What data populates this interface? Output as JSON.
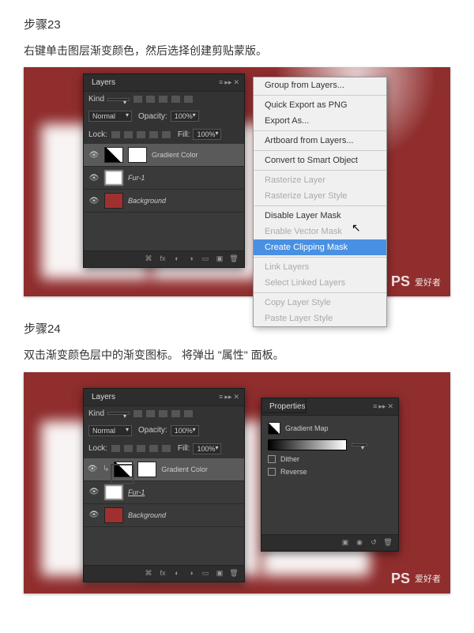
{
  "step23": {
    "title": "步骤23",
    "desc": "右键单击图层渐变颜色，然后选择创建剪贴蒙版。"
  },
  "step24": {
    "title": "步骤24",
    "desc": "双击渐变颜色层中的渐变图标。 将弹出 \"属性\" 面板。"
  },
  "layers": {
    "tab": "Layers",
    "kind_label": "Kind",
    "blend_mode": "Normal",
    "opacity_label": "Opacity:",
    "opacity_value": "100%",
    "lock_label": "Lock:",
    "fill_label": "Fill:",
    "fill_value": "100%",
    "item_gradient": "Gradient Color",
    "item_fur": "Fur-1",
    "item_bg": "Background",
    "foot_fx": "fx"
  },
  "ctx": {
    "group": "Group from Layers...",
    "export_png": "Quick Export as PNG",
    "export_as": "Export As...",
    "artboard": "Artboard from Layers...",
    "smart": "Convert to Smart Object",
    "rasterize": "Rasterize Layer",
    "rasterize_style": "Rasterize Layer Style",
    "disable_mask": "Disable Layer Mask",
    "vector_mask": "Enable Vector Mask",
    "clipping": "Create Clipping Mask",
    "link": "Link Layers",
    "select_linked": "Select Linked Layers",
    "copy_style": "Copy Layer Style",
    "paste_style": "Paste Layer Style"
  },
  "props": {
    "tab": "Properties",
    "title": "Gradient Map",
    "dither": "Dither",
    "reverse": "Reverse"
  },
  "watermark": {
    "logo": "PS",
    "text": "爱好者"
  }
}
